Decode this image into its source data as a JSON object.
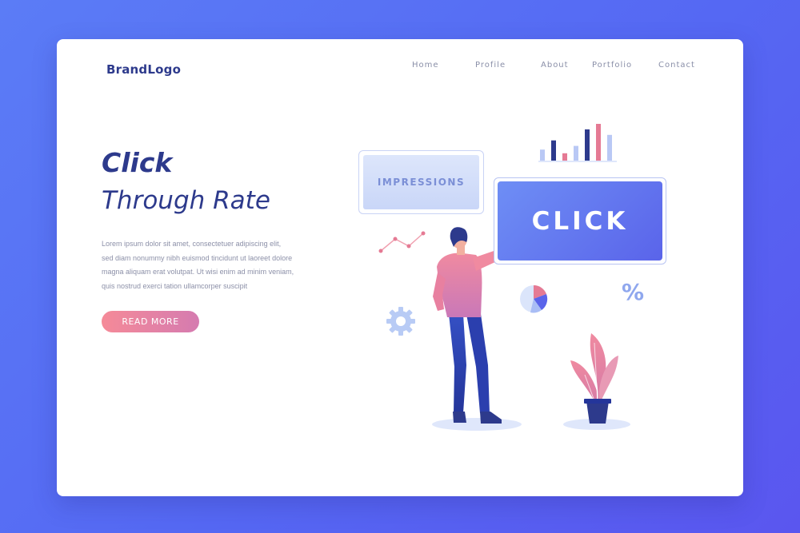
{
  "header": {
    "brand": "BrandLogo",
    "nav": [
      {
        "label": "Home"
      },
      {
        "label": "Profile"
      },
      {
        "label": "About"
      },
      {
        "label": "Portfolio"
      },
      {
        "label": "Contact"
      }
    ]
  },
  "hero": {
    "title_line1": "Click",
    "title_line2": "Through Rate",
    "body_lines": [
      "Lorem ipsum dolor sit amet, consectetuer adipiscing elit,",
      "sed diam nonummy nibh euismod tincidunt ut laoreet dolore",
      "magna aliquam erat volutpat. Ut wisi enim ad minim veniam,",
      "quis nostrud exerci tation ullamcorper suscipit"
    ],
    "cta_label": "READ MORE"
  },
  "illustration": {
    "impressions_label": "IMPRESSIONS",
    "click_label": "CLICK",
    "percent_symbol": "%",
    "bar_levels": [
      0.3,
      0.55,
      0.2,
      0.4,
      0.85,
      1.0,
      0.7
    ],
    "bar_colors": [
      "#b9c8f5",
      "#2d3a8c",
      "#e57a94",
      "#b9c8f5",
      "#2d3a8c",
      "#e57a94",
      "#b9c8f5"
    ]
  },
  "colors": {
    "primary": "#2d3a8c",
    "accent_blue": "#5a64ea",
    "accent_pink": "#f58a98",
    "background": "#5b7cf6"
  }
}
